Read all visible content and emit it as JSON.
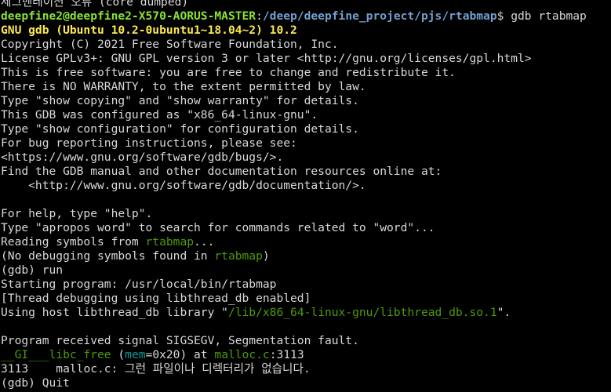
{
  "terminal": {
    "lines": [
      [
        {
          "t": "세그멘테이션 오류 (core dumped)"
        }
      ],
      [
        {
          "t": "deepfine2@deepfine2-X570-AORUS-MASTER",
          "c": "prompt-user"
        },
        {
          "t": ":"
        },
        {
          "t": "/deep/deepfine_project/pjs/rtabmap",
          "c": "prompt-path"
        },
        {
          "t": "$ gdb rtabmap"
        }
      ],
      [
        {
          "t": "GNU gdb (Ubuntu 10.2-0ubuntu1~18.04~2) 10.2",
          "c": "gdb-banner"
        }
      ],
      [
        {
          "t": "Copyright (C) 2021 Free Software Foundation, Inc."
        }
      ],
      [
        {
          "t": "License GPLv3+: GNU GPL version 3 or later <http://gnu.org/licenses/gpl.html>"
        }
      ],
      [
        {
          "t": "This is free software: you are free to change and redistribute it."
        }
      ],
      [
        {
          "t": "There is NO WARRANTY, to the extent permitted by law."
        }
      ],
      [
        {
          "t": "Type \"show copying\" and \"show warranty\" for details."
        }
      ],
      [
        {
          "t": "This GDB was configured as \"x86_64-linux-gnu\"."
        }
      ],
      [
        {
          "t": "Type \"show configuration\" for configuration details."
        }
      ],
      [
        {
          "t": "For bug reporting instructions, please see:"
        }
      ],
      [
        {
          "t": "<https://www.gnu.org/software/gdb/bugs/>."
        }
      ],
      [
        {
          "t": "Find the GDB manual and other documentation resources online at:"
        }
      ],
      [
        {
          "t": "    <http://www.gnu.org/software/gdb/documentation/>."
        }
      ],
      [
        {
          "t": ""
        }
      ],
      [
        {
          "t": "For help, type \"help\"."
        }
      ],
      [
        {
          "t": "Type \"apropos word\" to search for commands related to \"word\"..."
        }
      ],
      [
        {
          "t": "Reading symbols from "
        },
        {
          "t": "rtabmap",
          "c": "green"
        },
        {
          "t": "..."
        }
      ],
      [
        {
          "t": "(No debugging symbols found in "
        },
        {
          "t": "rtabmap",
          "c": "green"
        },
        {
          "t": ")"
        }
      ],
      [
        {
          "t": "(gdb) run"
        }
      ],
      [
        {
          "t": "Starting program: /usr/local/bin/rtabmap"
        }
      ],
      [
        {
          "t": "[Thread debugging using libthread_db enabled]"
        }
      ],
      [
        {
          "t": "Using host libthread_db library \""
        },
        {
          "t": "/lib/x86_64-linux-gnu/libthread_db.so.1",
          "c": "green"
        },
        {
          "t": "\"."
        }
      ],
      [
        {
          "t": ""
        }
      ],
      [
        {
          "t": "Program received signal SIGSEGV, Segmentation fault."
        }
      ],
      [
        {
          "t": "__GI___libc_free",
          "c": "green"
        },
        {
          "t": " ("
        },
        {
          "t": "mem",
          "c": "cyan"
        },
        {
          "t": "=0x20) at "
        },
        {
          "t": "malloc.c",
          "c": "green"
        },
        {
          "t": ":3113"
        }
      ],
      [
        {
          "t": "3113\tmalloc.c: 그런 파일이나 디렉터리가 없습니다."
        }
      ],
      [
        {
          "t": "(gdb) Quit"
        }
      ]
    ]
  },
  "colors": {
    "background": "#000000",
    "text": "#d8d8d8",
    "prompt_user": "#8ae234",
    "prompt_path": "#729fcf",
    "gdb_banner": "#fce94f",
    "green": "#4e9a06",
    "cyan": "#06989a"
  }
}
